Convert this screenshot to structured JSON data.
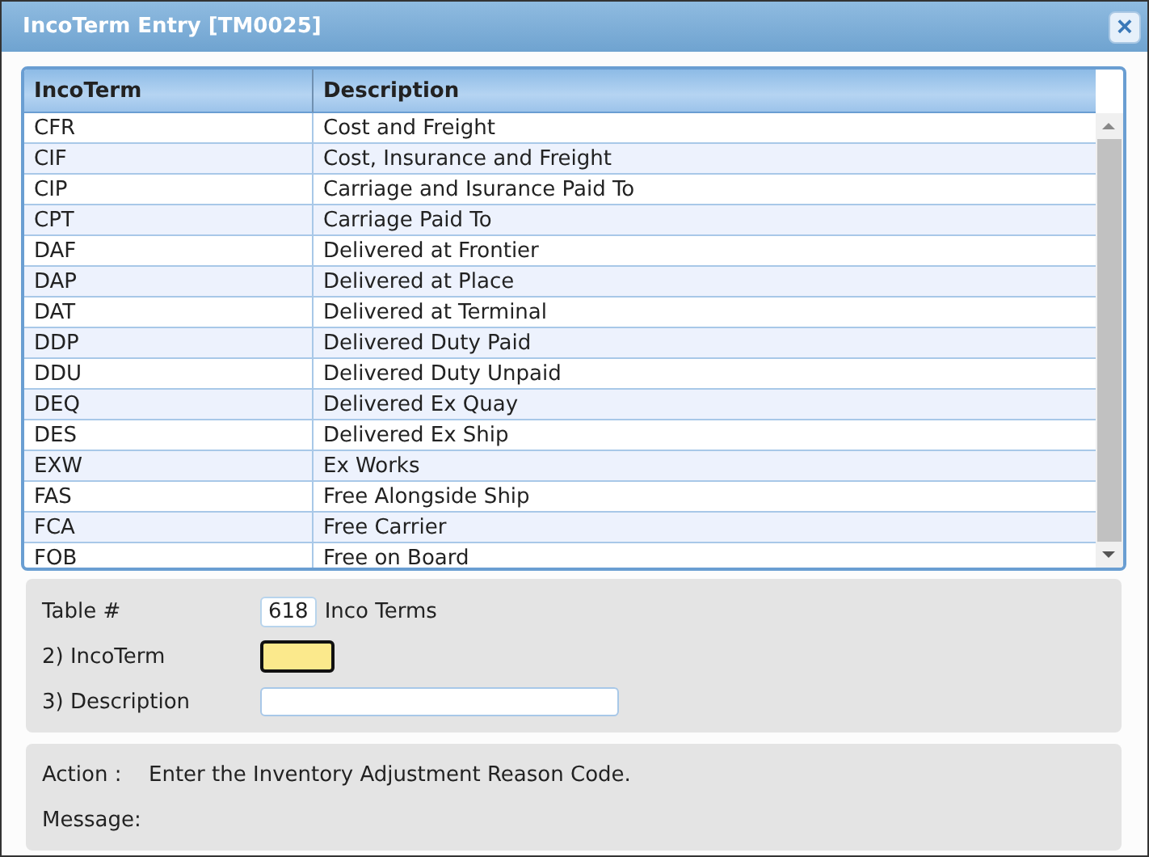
{
  "window": {
    "title": "IncoTerm Entry [TM0025]",
    "close_icon": "×"
  },
  "table": {
    "columns": [
      "IncoTerm",
      "Description"
    ],
    "rows": [
      {
        "code": "CFR",
        "description": "Cost and Freight"
      },
      {
        "code": "CIF",
        "description": "Cost, Insurance and Freight"
      },
      {
        "code": "CIP",
        "description": "Carriage and Isurance Paid To"
      },
      {
        "code": "CPT",
        "description": "Carriage Paid To"
      },
      {
        "code": "DAF",
        "description": "Delivered at Frontier"
      },
      {
        "code": "DAP",
        "description": "Delivered at Place"
      },
      {
        "code": "DAT",
        "description": "Delivered at Terminal"
      },
      {
        "code": "DDP",
        "description": "Delivered Duty Paid"
      },
      {
        "code": "DDU",
        "description": "Delivered Duty Unpaid"
      },
      {
        "code": "DEQ",
        "description": "Delivered Ex Quay"
      },
      {
        "code": "DES",
        "description": "Delivered Ex Ship"
      },
      {
        "code": "EXW",
        "description": "Ex Works"
      },
      {
        "code": "FAS",
        "description": "Free Alongside Ship"
      },
      {
        "code": "FCA",
        "description": "Free Carrier"
      },
      {
        "code": "FOB",
        "description": "Free on Board"
      }
    ]
  },
  "form": {
    "table_label": "Table #",
    "table_number": "618",
    "table_name": "Inco Terms",
    "fields": [
      {
        "label": "2) IncoTerm",
        "kind": "short",
        "focused": true
      },
      {
        "label": "3) Description",
        "kind": "long",
        "focused": false
      }
    ]
  },
  "status": {
    "action_label": "Action :",
    "action_text": "Enter the Inventory Adjustment Reason Code.",
    "message_label": "Message:"
  }
}
